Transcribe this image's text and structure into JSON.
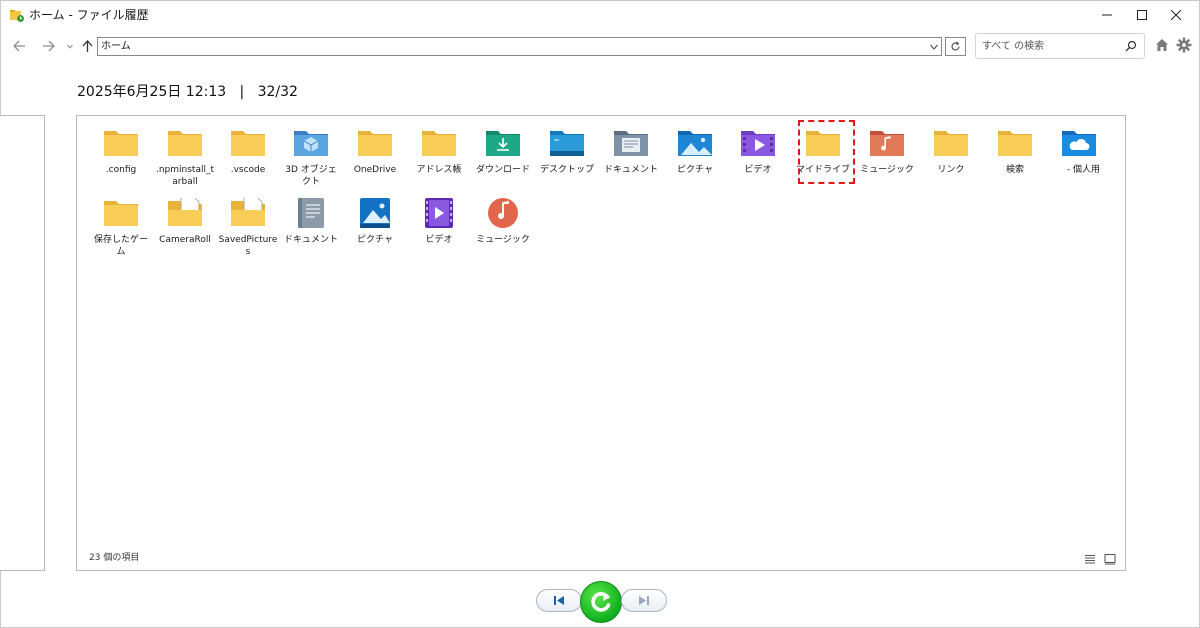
{
  "window": {
    "title": "ホーム - ファイル履歴"
  },
  "nav": {
    "address": "ホーム",
    "search_placeholder": "すべて の検索"
  },
  "header": {
    "date": "2025年6月25日 12:13",
    "separator": "|",
    "version": "32/32"
  },
  "items": [
    {
      "label": ".config",
      "icon": "folder-icon",
      "col": 0,
      "row": 0
    },
    {
      "label": ".npminstall_tarball",
      "icon": "folder-icon",
      "col": 1,
      "row": 0
    },
    {
      "label": ".vscode",
      "icon": "folder-icon",
      "col": 2,
      "row": 0
    },
    {
      "label": "3D オブジェクト",
      "icon": "3d-objects-folder-icon",
      "col": 3,
      "row": 0
    },
    {
      "label": "OneDrive",
      "icon": "folder-icon",
      "col": 4,
      "row": 0
    },
    {
      "label": "アドレス帳",
      "icon": "folder-icon",
      "col": 5,
      "row": 0
    },
    {
      "label": "ダウンロード",
      "icon": "downloads-folder-icon",
      "col": 6,
      "row": 0
    },
    {
      "label": "デスクトップ",
      "icon": "desktop-folder-icon",
      "col": 7,
      "row": 0
    },
    {
      "label": "ドキュメント",
      "icon": "documents-folder-icon",
      "col": 8,
      "row": 0
    },
    {
      "label": "ピクチャ",
      "icon": "pictures-folder-icon",
      "col": 9,
      "row": 0
    },
    {
      "label": "ビデオ",
      "icon": "videos-folder-icon",
      "col": 10,
      "row": 0
    },
    {
      "label": "マイドライブ",
      "icon": "folder-icon",
      "col": 11,
      "row": 0
    },
    {
      "label": "ミュージック",
      "icon": "music-folder-icon",
      "col": 12,
      "row": 0
    },
    {
      "label": "リンク",
      "icon": "folder-icon",
      "col": 13,
      "row": 0
    },
    {
      "label": "検索",
      "icon": "folder-icon",
      "col": 14,
      "row": 0
    },
    {
      "label": "　- 個人用",
      "icon": "onedrive-folder-icon",
      "col": 15,
      "row": 0
    },
    {
      "label": "保存したゲーム",
      "icon": "folder-icon",
      "col": 0,
      "row": 1
    },
    {
      "label": "CameraRoll",
      "icon": "folder-with-file-icon",
      "col": 1,
      "row": 1
    },
    {
      "label": "SavedPictures",
      "icon": "folder-with-file-icon",
      "col": 2,
      "row": 1
    },
    {
      "label": "ドキュメント",
      "icon": "documents-library-icon",
      "col": 3,
      "row": 1
    },
    {
      "label": "ピクチャ",
      "icon": "pictures-library-icon",
      "col": 4,
      "row": 1
    },
    {
      "label": "ビデオ",
      "icon": "videos-library-icon",
      "col": 5,
      "row": 1
    },
    {
      "label": "ミュージック",
      "icon": "music-library-icon",
      "col": 6,
      "row": 1
    }
  ],
  "selected_item": "マイドライブ",
  "status": {
    "count_text": "23 個の項目"
  },
  "colors": {
    "folder": "#f5c544",
    "selection": "#e01818",
    "restore_green": "#18b52a",
    "nav_pill_icon": "#1d5fa8"
  }
}
